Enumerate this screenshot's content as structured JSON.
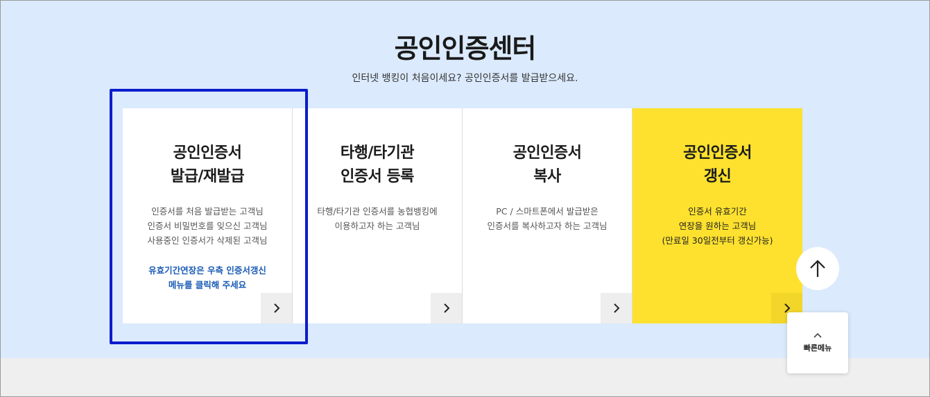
{
  "header": {
    "title": "공인인증센터",
    "subtitle": "인터넷 뱅킹이 처음이세요? 공인인증서를 발급받으세요."
  },
  "cards": [
    {
      "title_lines": [
        "공인인증서",
        "발급/재발급"
      ],
      "desc_lines": [
        "인증서를 처음 발급받는 고객님",
        "인증서 비밀번호를 잊으신 고객님",
        "사용중인 인증서가 삭제된 고객님"
      ],
      "note_lines": [
        "유효기간연장은 우측 인증서갱신",
        "메뉴를 클릭해 주세요"
      ]
    },
    {
      "title_lines": [
        "타행/타기관",
        "인증서 등록"
      ],
      "desc_lines": [
        "타행/타기관 인증서를 농협뱅킹에",
        "이용하고자 하는 고객님"
      ]
    },
    {
      "title_lines": [
        "공인인증서",
        "복사"
      ],
      "desc_lines": [
        "PC / 스마트폰에서 발급받은",
        "인증서를 복사하고자 하는 고객님"
      ]
    },
    {
      "title_lines": [
        "공인인증서",
        "갱신"
      ],
      "desc_lines": [
        "인증서 유효기간",
        "연장을 원하는 고객님",
        "(만료일 30일전부터 갱신가능)"
      ]
    }
  ],
  "floating": {
    "quick_menu_label": "빠른메뉴"
  },
  "colors": {
    "hero_bg": "#dbeafc",
    "renew_card": "#fde12e",
    "note_text": "#1a5bb5",
    "highlight_border": "#0a1ccc"
  }
}
